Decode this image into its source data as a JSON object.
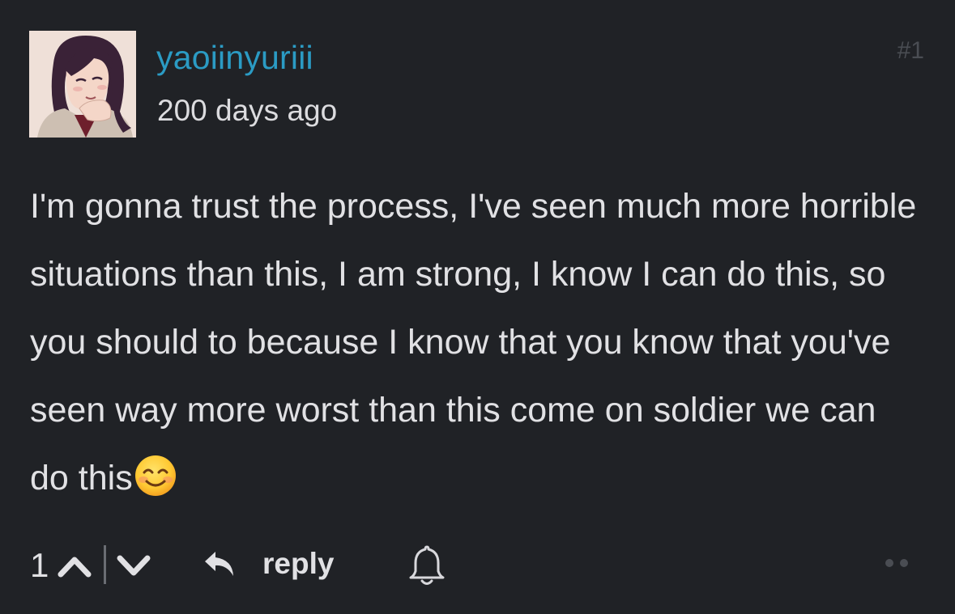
{
  "comment": {
    "number": "#1",
    "username": "yaoiinyuriii",
    "timestamp": "200 days ago",
    "body": "I'm gonna trust the process, I've seen much more horrible situations than this, I am strong, I know I can do this, so you should to because I know that you know that you've seen way more worst than this come on soldier we can do this",
    "emoji": "smiling-face-with-smiling-eyes"
  },
  "actions": {
    "vote_count": "1",
    "reply_label": "reply",
    "icons": {
      "upvote": "chevron-up-icon",
      "downvote": "chevron-down-icon",
      "reply": "reply-arrow-icon",
      "notify": "bell-icon",
      "more": "more-dots-icon"
    }
  },
  "colors": {
    "background": "#202226",
    "username": "#2b9bc4",
    "text": "#e1e1e4",
    "muted": "#4a4d53"
  }
}
